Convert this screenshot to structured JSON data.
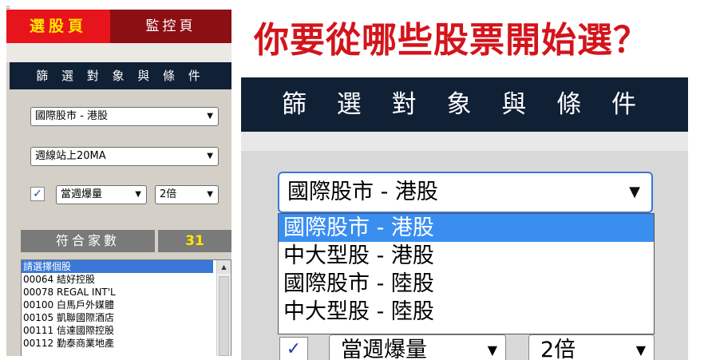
{
  "tabs": {
    "active": "選股頁",
    "inactive": "監控頁"
  },
  "corner_glyph": "⠿",
  "panel_header": "篩 選 對 象 與 條 件",
  "filters": {
    "market": "國際股市 - 港股",
    "condition": "週線站上20MA",
    "volume_checked": "✓",
    "volume": "當週爆量",
    "multiplier": "2倍"
  },
  "count": {
    "label": "符合家數",
    "value": "31"
  },
  "stock_list": [
    "請選擇個股",
    "00064 結好控股",
    "00078 REGAL INT'L",
    "00100 白馬戶外媒體",
    "00105 凱聯國際酒店",
    "00111 信達國際控股",
    "00112 勤泰商業地產"
  ],
  "scroll_up": "▲",
  "question": "你要從哪些股票開始選？",
  "zoom_header": "篩 選 對 象 與 條 件",
  "dropdown": {
    "selected": "國際股市 - 港股",
    "arrow": "▼",
    "options": [
      "國際股市 - 港股",
      "中大型股 - 港股",
      "國際股市 - 陸股",
      "中大型股 - 陸股"
    ]
  },
  "zoom_volume": "當週爆量",
  "zoom_multiplier": "2倍",
  "colors": {
    "brand_red": "#d3141b",
    "header_navy": "#102035",
    "highlight_blue": "#3a8ef0",
    "count_yellow": "#ffe600"
  }
}
